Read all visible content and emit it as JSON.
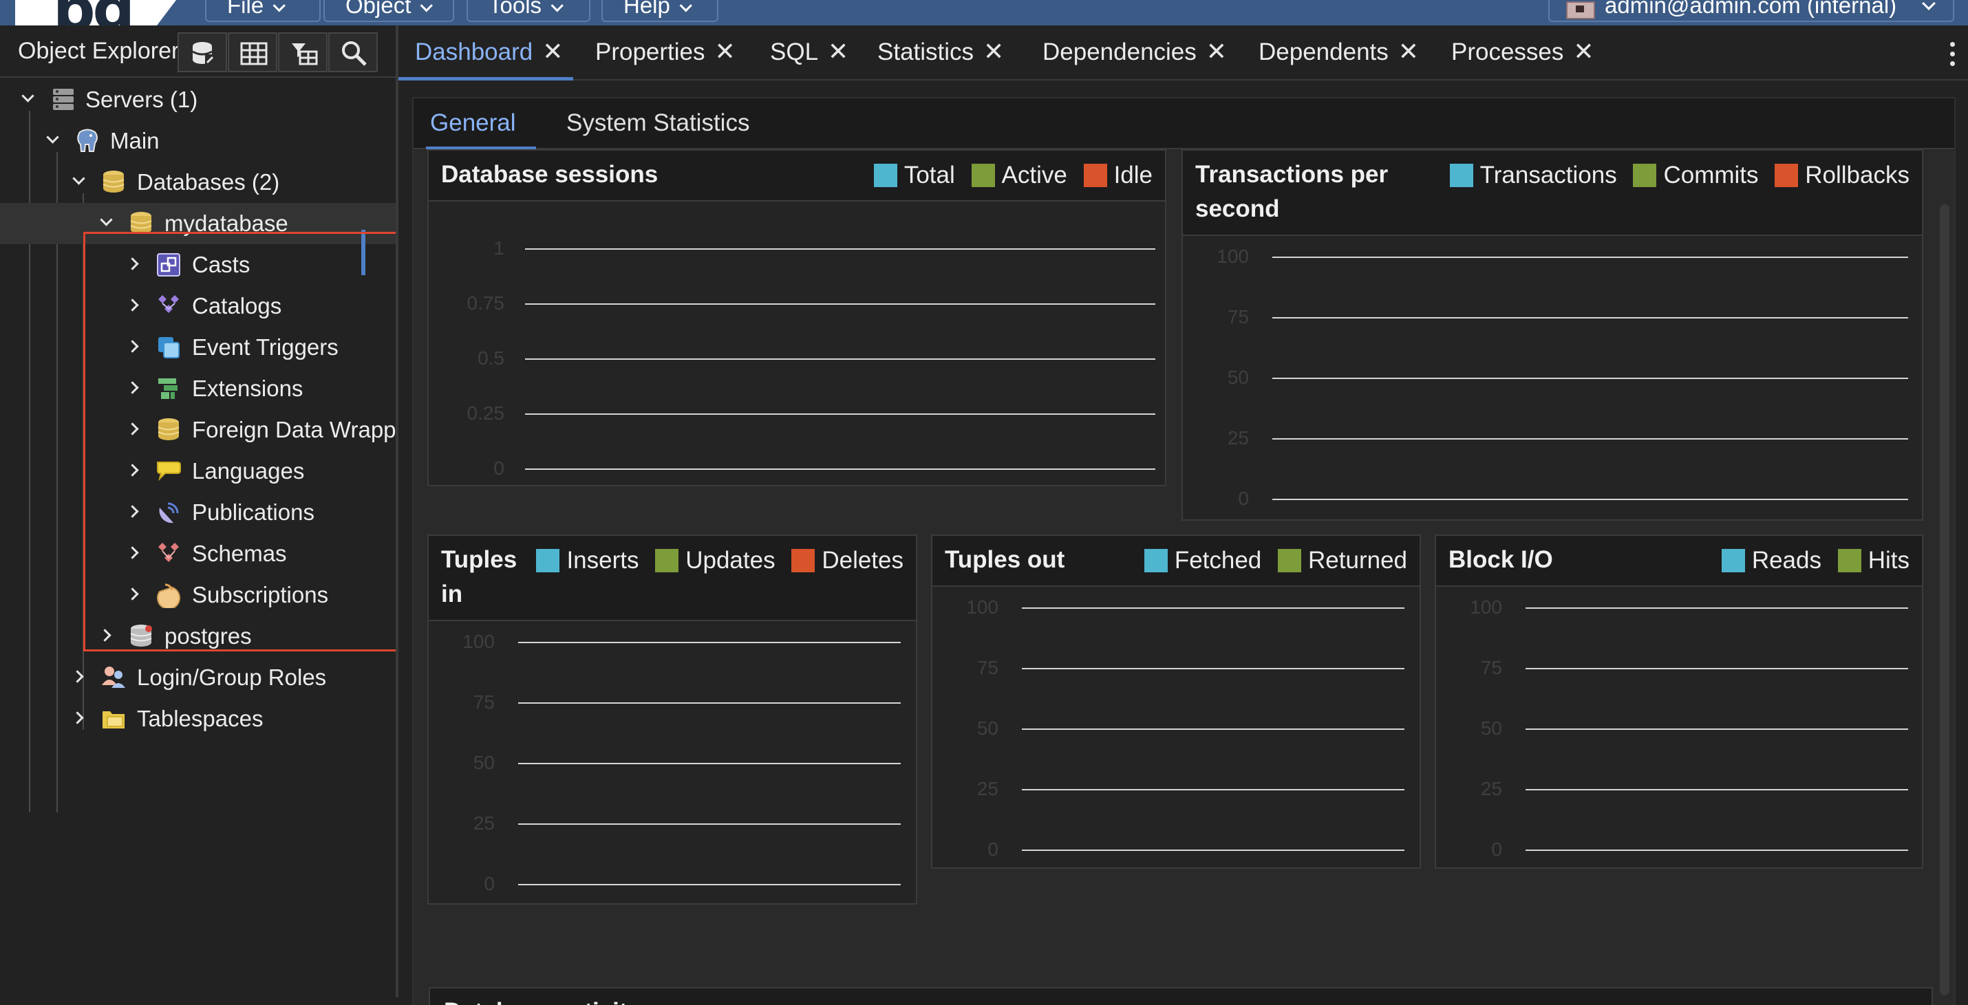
{
  "menubar": {
    "logo_text": "pg",
    "menus": [
      "File",
      "Object",
      "Tools",
      "Help"
    ],
    "user": "admin@admin.com (internal)"
  },
  "object_explorer": {
    "title": "Object Explorer",
    "toolbar": [
      "database-icon",
      "table-icon",
      "filter-table-icon",
      "search-icon"
    ]
  },
  "tree": [
    {
      "label": "Servers (1)",
      "icon": "servers-icon"
    },
    {
      "label": "Main",
      "icon": "elephant-icon"
    },
    {
      "label": "Databases (2)",
      "icon": "databases-icon"
    },
    {
      "label": "mydatabase",
      "icon": "database-icon"
    },
    {
      "label": "Casts",
      "icon": "casts-icon"
    },
    {
      "label": "Catalogs",
      "icon": "catalogs-icon"
    },
    {
      "label": "Event Triggers",
      "icon": "event-triggers-icon"
    },
    {
      "label": "Extensions",
      "icon": "extensions-icon"
    },
    {
      "label": "Foreign Data Wrappers",
      "icon": "foreign-data-wrappers-icon"
    },
    {
      "label": "Languages",
      "icon": "languages-icon"
    },
    {
      "label": "Publications",
      "icon": "publications-icon"
    },
    {
      "label": "Schemas",
      "icon": "schemas-icon"
    },
    {
      "label": "Subscriptions",
      "icon": "subscriptions-icon"
    },
    {
      "label": "postgres",
      "icon": "database-icon"
    },
    {
      "label": "Login/Group Roles",
      "icon": "roles-icon"
    },
    {
      "label": "Tablespaces",
      "icon": "tablespaces-icon"
    }
  ],
  "tabs": [
    "Dashboard",
    "Properties",
    "SQL",
    "Statistics",
    "Dependencies",
    "Dependents",
    "Processes"
  ],
  "subtabs": [
    "General",
    "System Statistics"
  ],
  "colors": {
    "blue": "#4fb6d0",
    "green": "#7d9c3a",
    "red": "#d9532b",
    "accent": "#4f80c6",
    "highlight": "#e0452d"
  },
  "cards": [
    {
      "title": "Database sessions",
      "legend": [
        "Total",
        "Active",
        "Idle"
      ],
      "ticks": [
        "1",
        "0.75",
        "0.5",
        "0.25",
        "0"
      ]
    },
    {
      "title": "Transactions per second",
      "legend": [
        "Transactions",
        "Commits",
        "Rollbacks"
      ],
      "ticks": [
        "100",
        "75",
        "50",
        "25",
        "0"
      ]
    },
    {
      "title": "Tuples in",
      "legend": [
        "Inserts",
        "Updates",
        "Deletes"
      ],
      "ticks": [
        "100",
        "75",
        "50",
        "25",
        "0"
      ]
    },
    {
      "title": "Tuples out",
      "legend": [
        "Fetched",
        "Returned"
      ],
      "ticks": [
        "100",
        "75",
        "50",
        "25",
        "0"
      ]
    },
    {
      "title": "Block I/O",
      "legend": [
        "Reads",
        "Hits"
      ],
      "ticks": [
        "100",
        "75",
        "50",
        "25",
        "0"
      ]
    }
  ],
  "activity_title": "Database activity"
}
